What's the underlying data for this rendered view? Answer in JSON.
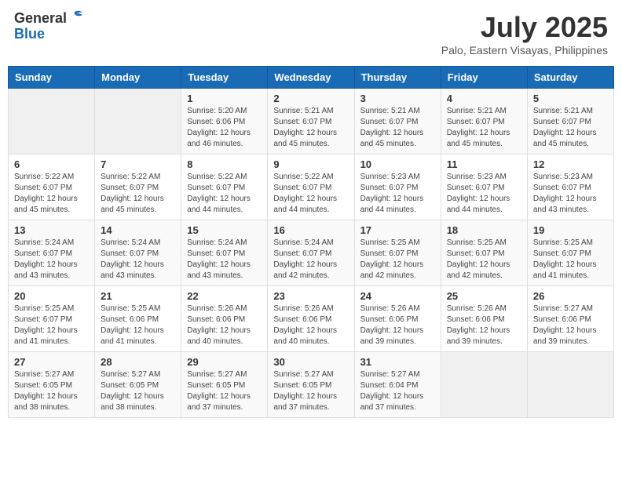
{
  "header": {
    "logo_general": "General",
    "logo_blue": "Blue",
    "month_year": "July 2025",
    "location": "Palo, Eastern Visayas, Philippines"
  },
  "days_of_week": [
    "Sunday",
    "Monday",
    "Tuesday",
    "Wednesday",
    "Thursday",
    "Friday",
    "Saturday"
  ],
  "weeks": [
    [
      {
        "day": "",
        "sunrise": "",
        "sunset": "",
        "daylight": ""
      },
      {
        "day": "",
        "sunrise": "",
        "sunset": "",
        "daylight": ""
      },
      {
        "day": "1",
        "sunrise": "Sunrise: 5:20 AM",
        "sunset": "Sunset: 6:06 PM",
        "daylight": "Daylight: 12 hours and 46 minutes."
      },
      {
        "day": "2",
        "sunrise": "Sunrise: 5:21 AM",
        "sunset": "Sunset: 6:07 PM",
        "daylight": "Daylight: 12 hours and 45 minutes."
      },
      {
        "day": "3",
        "sunrise": "Sunrise: 5:21 AM",
        "sunset": "Sunset: 6:07 PM",
        "daylight": "Daylight: 12 hours and 45 minutes."
      },
      {
        "day": "4",
        "sunrise": "Sunrise: 5:21 AM",
        "sunset": "Sunset: 6:07 PM",
        "daylight": "Daylight: 12 hours and 45 minutes."
      },
      {
        "day": "5",
        "sunrise": "Sunrise: 5:21 AM",
        "sunset": "Sunset: 6:07 PM",
        "daylight": "Daylight: 12 hours and 45 minutes."
      }
    ],
    [
      {
        "day": "6",
        "sunrise": "Sunrise: 5:22 AM",
        "sunset": "Sunset: 6:07 PM",
        "daylight": "Daylight: 12 hours and 45 minutes."
      },
      {
        "day": "7",
        "sunrise": "Sunrise: 5:22 AM",
        "sunset": "Sunset: 6:07 PM",
        "daylight": "Daylight: 12 hours and 45 minutes."
      },
      {
        "day": "8",
        "sunrise": "Sunrise: 5:22 AM",
        "sunset": "Sunset: 6:07 PM",
        "daylight": "Daylight: 12 hours and 44 minutes."
      },
      {
        "day": "9",
        "sunrise": "Sunrise: 5:22 AM",
        "sunset": "Sunset: 6:07 PM",
        "daylight": "Daylight: 12 hours and 44 minutes."
      },
      {
        "day": "10",
        "sunrise": "Sunrise: 5:23 AM",
        "sunset": "Sunset: 6:07 PM",
        "daylight": "Daylight: 12 hours and 44 minutes."
      },
      {
        "day": "11",
        "sunrise": "Sunrise: 5:23 AM",
        "sunset": "Sunset: 6:07 PM",
        "daylight": "Daylight: 12 hours and 44 minutes."
      },
      {
        "day": "12",
        "sunrise": "Sunrise: 5:23 AM",
        "sunset": "Sunset: 6:07 PM",
        "daylight": "Daylight: 12 hours and 43 minutes."
      }
    ],
    [
      {
        "day": "13",
        "sunrise": "Sunrise: 5:24 AM",
        "sunset": "Sunset: 6:07 PM",
        "daylight": "Daylight: 12 hours and 43 minutes."
      },
      {
        "day": "14",
        "sunrise": "Sunrise: 5:24 AM",
        "sunset": "Sunset: 6:07 PM",
        "daylight": "Daylight: 12 hours and 43 minutes."
      },
      {
        "day": "15",
        "sunrise": "Sunrise: 5:24 AM",
        "sunset": "Sunset: 6:07 PM",
        "daylight": "Daylight: 12 hours and 43 minutes."
      },
      {
        "day": "16",
        "sunrise": "Sunrise: 5:24 AM",
        "sunset": "Sunset: 6:07 PM",
        "daylight": "Daylight: 12 hours and 42 minutes."
      },
      {
        "day": "17",
        "sunrise": "Sunrise: 5:25 AM",
        "sunset": "Sunset: 6:07 PM",
        "daylight": "Daylight: 12 hours and 42 minutes."
      },
      {
        "day": "18",
        "sunrise": "Sunrise: 5:25 AM",
        "sunset": "Sunset: 6:07 PM",
        "daylight": "Daylight: 12 hours and 42 minutes."
      },
      {
        "day": "19",
        "sunrise": "Sunrise: 5:25 AM",
        "sunset": "Sunset: 6:07 PM",
        "daylight": "Daylight: 12 hours and 41 minutes."
      }
    ],
    [
      {
        "day": "20",
        "sunrise": "Sunrise: 5:25 AM",
        "sunset": "Sunset: 6:07 PM",
        "daylight": "Daylight: 12 hours and 41 minutes."
      },
      {
        "day": "21",
        "sunrise": "Sunrise: 5:25 AM",
        "sunset": "Sunset: 6:06 PM",
        "daylight": "Daylight: 12 hours and 41 minutes."
      },
      {
        "day": "22",
        "sunrise": "Sunrise: 5:26 AM",
        "sunset": "Sunset: 6:06 PM",
        "daylight": "Daylight: 12 hours and 40 minutes."
      },
      {
        "day": "23",
        "sunrise": "Sunrise: 5:26 AM",
        "sunset": "Sunset: 6:06 PM",
        "daylight": "Daylight: 12 hours and 40 minutes."
      },
      {
        "day": "24",
        "sunrise": "Sunrise: 5:26 AM",
        "sunset": "Sunset: 6:06 PM",
        "daylight": "Daylight: 12 hours and 39 minutes."
      },
      {
        "day": "25",
        "sunrise": "Sunrise: 5:26 AM",
        "sunset": "Sunset: 6:06 PM",
        "daylight": "Daylight: 12 hours and 39 minutes."
      },
      {
        "day": "26",
        "sunrise": "Sunrise: 5:27 AM",
        "sunset": "Sunset: 6:06 PM",
        "daylight": "Daylight: 12 hours and 39 minutes."
      }
    ],
    [
      {
        "day": "27",
        "sunrise": "Sunrise: 5:27 AM",
        "sunset": "Sunset: 6:05 PM",
        "daylight": "Daylight: 12 hours and 38 minutes."
      },
      {
        "day": "28",
        "sunrise": "Sunrise: 5:27 AM",
        "sunset": "Sunset: 6:05 PM",
        "daylight": "Daylight: 12 hours and 38 minutes."
      },
      {
        "day": "29",
        "sunrise": "Sunrise: 5:27 AM",
        "sunset": "Sunset: 6:05 PM",
        "daylight": "Daylight: 12 hours and 37 minutes."
      },
      {
        "day": "30",
        "sunrise": "Sunrise: 5:27 AM",
        "sunset": "Sunset: 6:05 PM",
        "daylight": "Daylight: 12 hours and 37 minutes."
      },
      {
        "day": "31",
        "sunrise": "Sunrise: 5:27 AM",
        "sunset": "Sunset: 6:04 PM",
        "daylight": "Daylight: 12 hours and 37 minutes."
      },
      {
        "day": "",
        "sunrise": "",
        "sunset": "",
        "daylight": ""
      },
      {
        "day": "",
        "sunrise": "",
        "sunset": "",
        "daylight": ""
      }
    ]
  ]
}
